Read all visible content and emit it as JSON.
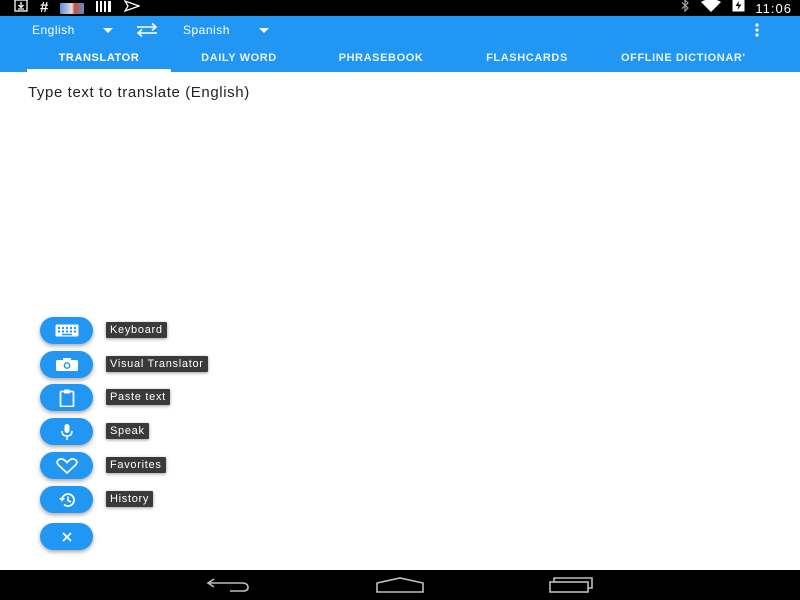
{
  "status_bar": {
    "time": "11:06",
    "left_icons": [
      "download-icon",
      "hash-icon",
      "app-thumbnail-icon",
      "barcode-icon",
      "send-icon"
    ],
    "right_icons": [
      "bluetooth-icon",
      "wifi-icon",
      "battery-charging-icon"
    ]
  },
  "language_bar": {
    "source_language": "English",
    "target_language": "Spanish",
    "swap_icon": "swap-arrows-icon",
    "menu_icon": "overflow-menu-icon"
  },
  "tabs": [
    {
      "label": "TRANSLATOR",
      "active": true
    },
    {
      "label": "DAILY WORD",
      "active": false
    },
    {
      "label": "PHRASEBOOK",
      "active": false
    },
    {
      "label": "FLASHCARDS",
      "active": false
    },
    {
      "label": "OFFLINE DICTIONAR'",
      "active": false
    }
  ],
  "input": {
    "placeholder": "Type text to translate (English)"
  },
  "fab_menu": {
    "items": [
      {
        "label": "Keyboard",
        "icon": "keyboard-icon"
      },
      {
        "label": "Visual Translator",
        "icon": "camera-icon"
      },
      {
        "label": "Paste text",
        "icon": "clipboard-icon"
      },
      {
        "label": "Speak",
        "icon": "microphone-icon"
      },
      {
        "label": "Favorites",
        "icon": "heart-icon"
      },
      {
        "label": "History",
        "icon": "history-icon"
      }
    ],
    "close_icon": "close-icon"
  },
  "nav_bar": {
    "icons": [
      "back-icon",
      "home-icon",
      "recent-apps-icon"
    ]
  },
  "colors": {
    "accent": "#2196f3",
    "status_bar": "#000000",
    "tooltip": "#3a3a3a"
  }
}
